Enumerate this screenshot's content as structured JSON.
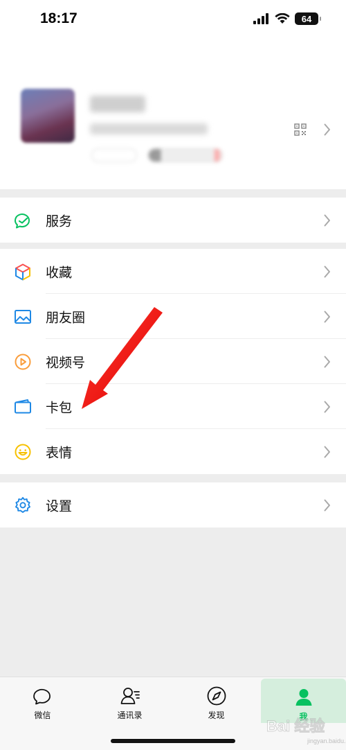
{
  "status_bar": {
    "time": "18:17",
    "battery": "64"
  },
  "profile": {
    "qr_icon": "qr-code-icon",
    "chevron": "chevron-right-icon"
  },
  "menu": {
    "services": {
      "label": "服务",
      "icon": "services-icon",
      "color": "#07c160"
    },
    "favorites": {
      "label": "收藏",
      "icon": "favorites-cube-icon"
    },
    "moments": {
      "label": "朋友圈",
      "icon": "moments-image-icon",
      "color": "#1e88e5"
    },
    "channels": {
      "label": "视频号",
      "icon": "channels-play-icon",
      "color": "#fa9d3b"
    },
    "cards": {
      "label": "卡包",
      "icon": "card-wallet-icon",
      "color": "#1e88e5"
    },
    "stickers": {
      "label": "表情",
      "icon": "sticker-smile-icon",
      "color": "#f7c100"
    },
    "settings": {
      "label": "设置",
      "icon": "settings-gear-icon",
      "color": "#1e88e5"
    }
  },
  "tab_bar": {
    "tabs": [
      {
        "label": "微信",
        "icon": "chat-bubble-icon"
      },
      {
        "label": "通讯录",
        "icon": "contacts-icon"
      },
      {
        "label": "发现",
        "icon": "compass-icon"
      },
      {
        "label": "我",
        "icon": "me-person-icon",
        "active": true
      }
    ],
    "active_color": "#07c160"
  },
  "watermark": {
    "text": "Bai 经验",
    "sub": "jingyan.baidu.com"
  }
}
